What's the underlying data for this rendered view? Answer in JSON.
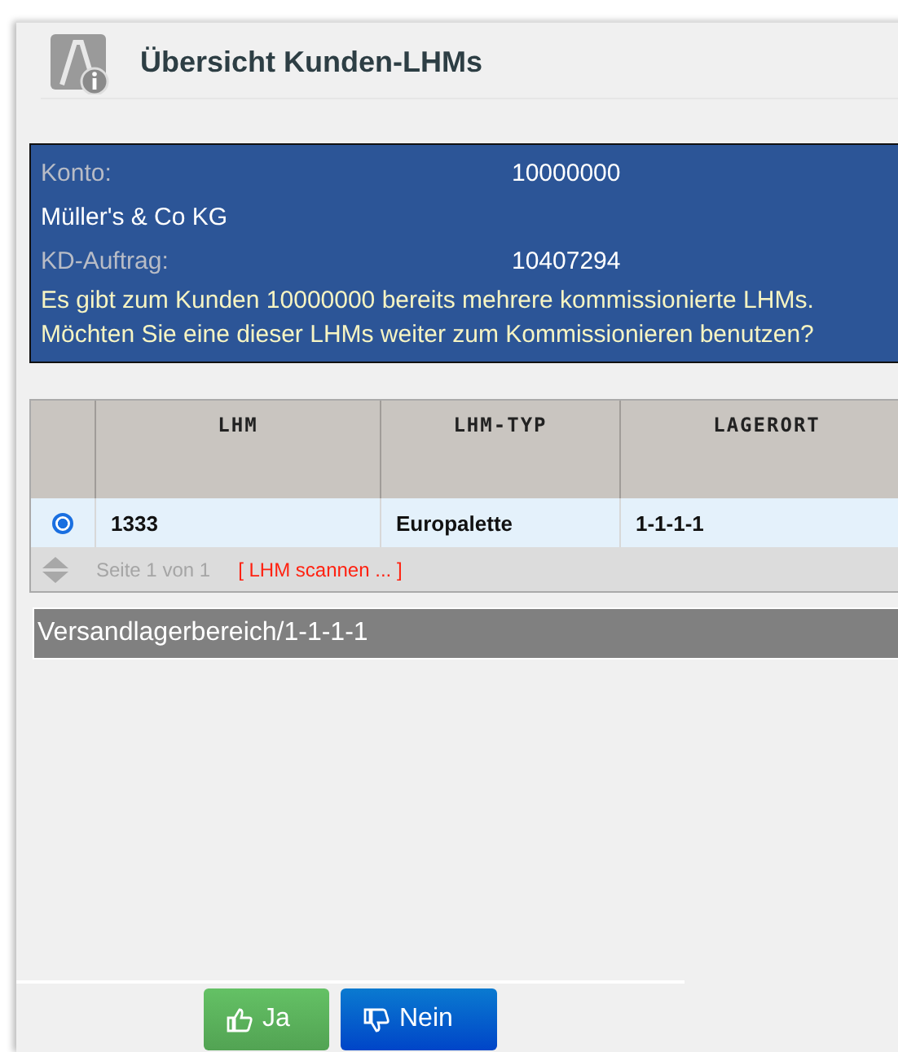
{
  "window": {
    "title": "Übersicht Kunden-LHMs"
  },
  "info": {
    "rows": [
      {
        "label": "Konto:",
        "value": "10000000"
      }
    ],
    "customer": "Müller's & Co KG",
    "order_label": "KD-Auftrag:",
    "order_value": "10407294",
    "message": "Es gibt zum Kunden 10000000 bereits mehrere kommissionierte LHMs. Möchten Sie eine dieser LHMs weiter zum Kommissionieren benutzen?"
  },
  "table": {
    "columns": [
      "LHM",
      "LHM-TYP",
      "LAGERORT"
    ],
    "rows": [
      {
        "selected": true,
        "cells": [
          "1333",
          "Europalette",
          "1-1-1-1"
        ]
      }
    ],
    "pager": "Seite 1 von 1",
    "scan_hint": "[ LHM scannen ... ]"
  },
  "location_bar": "Versandlagerbereich/1-1-1-1",
  "buttons": [
    {
      "kind": "yes",
      "label": "Ja"
    },
    {
      "kind": "no",
      "label": "Nein"
    }
  ]
}
